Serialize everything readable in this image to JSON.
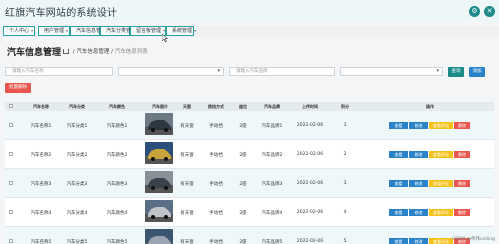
{
  "app": {
    "title": "红旗汽车网站的系统设计"
  },
  "nav": {
    "items": [
      {
        "label": "个人中心"
      },
      {
        "label": "用户管理"
      },
      {
        "label": "汽车信息管理"
      },
      {
        "label": "汽车分类管理"
      },
      {
        "label": "留言板管理"
      },
      {
        "label": "系统管理"
      }
    ]
  },
  "page": {
    "title": "汽车信息管理",
    "breadcrumb": {
      "sep": "/",
      "section": "汽车信息管理",
      "current": "汽车信息列表"
    }
  },
  "filters": {
    "name_placeholder": "请输入汽车名称",
    "brand_placeholder": "请输入汽车品牌",
    "query_label": "查询",
    "add_label": "添加",
    "batch_delete_label": "批量删除"
  },
  "table": {
    "headers": [
      "汽车名称",
      "汽车分类",
      "汽车颜色",
      "汽车图片",
      "天窗",
      "换挡方式",
      "座位",
      "汽车品牌",
      "上传时间",
      "积分",
      "操作"
    ],
    "rows": [
      {
        "name": "汽车名称1",
        "category": "汽车分类1",
        "color": "汽车颜色1",
        "sunroof": "有天窗",
        "gear": "手动挡",
        "seats": "2座",
        "brand": "汽车品牌1",
        "date": "2022-02-06",
        "points": "1"
      },
      {
        "name": "汽车名称2",
        "category": "汽车分类2",
        "color": "汽车颜色2",
        "sunroof": "有天窗",
        "gear": "手动挡",
        "seats": "2座",
        "brand": "汽车品牌2",
        "date": "2022-02-06",
        "points": "2"
      },
      {
        "name": "汽车名称3",
        "category": "汽车分类3",
        "color": "汽车颜色3",
        "sunroof": "有天窗",
        "gear": "手动挡",
        "seats": "2座",
        "brand": "汽车品牌3",
        "date": "2022-02-06",
        "points": "3"
      },
      {
        "name": "汽车名称4",
        "category": "汽车分类4",
        "color": "汽车颜色4",
        "sunroof": "有天窗",
        "gear": "手动挡",
        "seats": "2座",
        "brand": "汽车品牌4",
        "date": "2022-02-06",
        "points": "4"
      },
      {
        "name": "汽车名称5",
        "category": "汽车分类5",
        "color": "汽车颜色5",
        "sunroof": "有天窗",
        "gear": "手动挡",
        "seats": "2座",
        "brand": "汽车品牌5",
        "date": "2022-02-06",
        "points": "5"
      }
    ],
    "actions": {
      "view": "查看",
      "edit": "修改",
      "comment": "查看评论",
      "delete": "删除"
    }
  },
  "watermark": "CSDN @伟伟coding",
  "colors": {
    "accent": "#1d8a8a",
    "blue": "#2a83c8",
    "red": "#e9564d",
    "yellow": "#f5c21b"
  }
}
